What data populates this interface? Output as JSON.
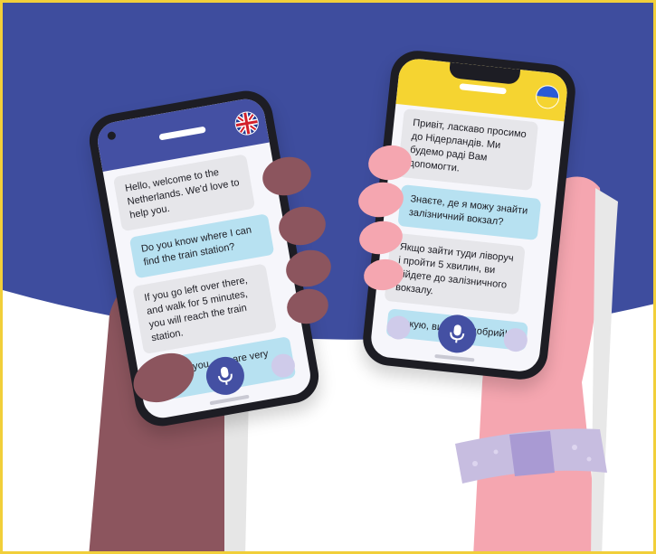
{
  "colors": {
    "sky_blue": "#3e4d9e",
    "phone_body": "#1d1d24",
    "left_header": "#4450a3",
    "right_header": "#f5d431",
    "grey_bubble": "#e6e6ea",
    "blue_bubble": "#b7e1f1",
    "mic_button": "#4450a3",
    "side_dots": "#cfcbea",
    "dark_hand": "#8c555e",
    "light_hand": "#f5a6b0",
    "wristband": "#c7bde0"
  },
  "left_phone": {
    "flag_icon": "uk-flag-icon",
    "messages": [
      "Hello, welcome to the Netherlands. We'd love to help you.",
      "Do you know where I can find the train station?",
      "If you go left over there, and walk for 5 minutes, you will reach the train station.",
      "Thank you, you are very kind!"
    ]
  },
  "right_phone": {
    "flag_icon": "ukraine-flag-icon",
    "messages": [
      "Привіт, ласкаво просимо до Нідерландів. Ми будемо раді Вам допомогти.",
      "Знаєте, де я можу знайти залізничний вокзал?",
      "Якщо зайти туди ліворуч і пройти 5 хвилин, ви дійдете до залізничного вокзалу.",
      "Дякую, ви дуже добрий!"
    ]
  }
}
